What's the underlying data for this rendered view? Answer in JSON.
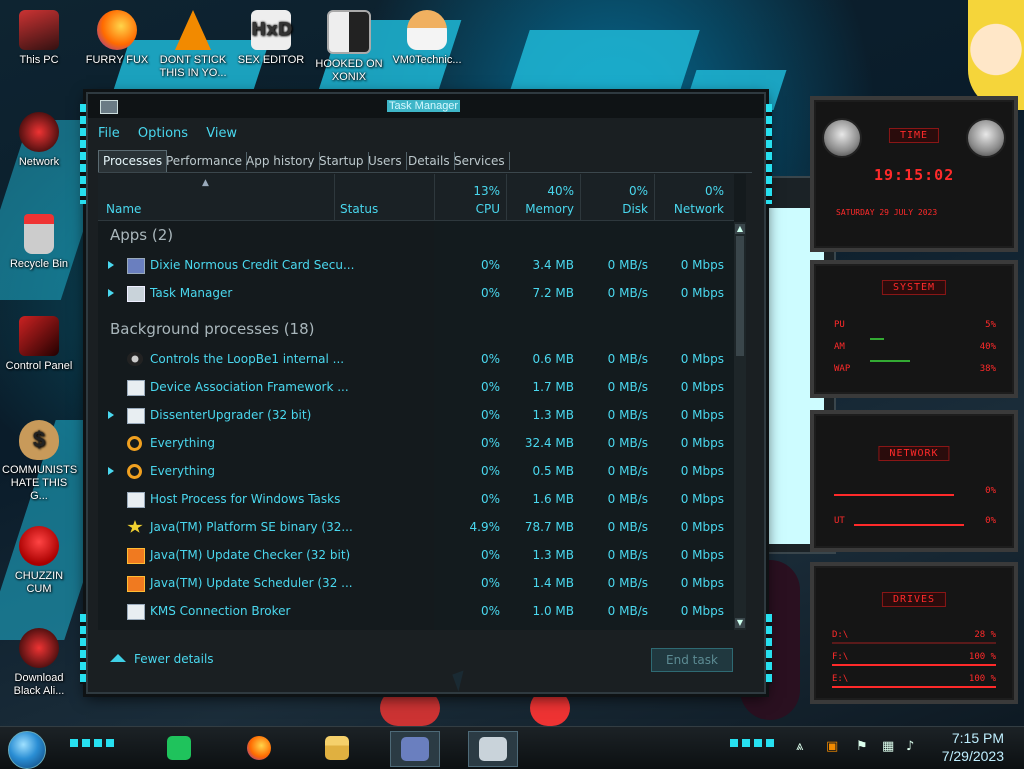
{
  "desktop_icons": [
    {
      "id": "this-pc",
      "label": "This PC"
    },
    {
      "id": "furry-fux",
      "label": "FURRY FUX"
    },
    {
      "id": "dont-stick",
      "label": "DONT STICK THIS IN YO..."
    },
    {
      "id": "sex-editor",
      "label": "SEX EDITOR"
    },
    {
      "id": "hooked-on-xonix",
      "label": "HOOKED ON XONIX"
    },
    {
      "id": "vm0technic",
      "label": "VM0Technic..."
    },
    {
      "id": "network",
      "label": "Network"
    },
    {
      "id": "recycle-bin",
      "label": "Recycle Bin"
    },
    {
      "id": "control-panel",
      "label": "Control Panel"
    },
    {
      "id": "communists",
      "label": "COMMUNISTS HATE THIS G..."
    },
    {
      "id": "chuzzin-cum",
      "label": "CHUZZIN CUM"
    },
    {
      "id": "download-black-ali",
      "label": "Download Black Ali..."
    }
  ],
  "task_manager": {
    "title": "Task Manager",
    "menu": [
      "File",
      "Options",
      "View"
    ],
    "tabs": [
      "Processes",
      "Performance",
      "App history",
      "Startup",
      "Users",
      "Details",
      "Services"
    ],
    "columns": {
      "name": "Name",
      "status": "Status",
      "cpu_pct": "13%",
      "cpu": "CPU",
      "memory_pct": "40%",
      "memory": "Memory",
      "disk_pct": "0%",
      "disk": "Disk",
      "network_pct": "0%",
      "network": "Network"
    },
    "groups": {
      "apps": "Apps (2)",
      "background": "Background processes (18)"
    },
    "apps": [
      {
        "name": "Dixie Normous Credit Card Secu...",
        "cpu": "0%",
        "memory": "3.4 MB",
        "disk": "0 MB/s",
        "network": "0 Mbps",
        "expandable": true,
        "icon": "card-icon"
      },
      {
        "name": "Task Manager",
        "cpu": "0%",
        "memory": "7.2 MB",
        "disk": "0 MB/s",
        "network": "0 Mbps",
        "expandable": true,
        "icon": "task-manager-icon"
      }
    ],
    "background": [
      {
        "name": "Controls the LoopBe1 internal ...",
        "cpu": "0%",
        "memory": "0.6 MB",
        "disk": "0 MB/s",
        "network": "0 Mbps",
        "expandable": false,
        "icon": "loopbe-icon"
      },
      {
        "name": "Device Association Framework ...",
        "cpu": "0%",
        "memory": "1.7 MB",
        "disk": "0 MB/s",
        "network": "0 Mbps",
        "expandable": false,
        "icon": "window-icon"
      },
      {
        "name": "DissenterUpgrader (32 bit)",
        "cpu": "0%",
        "memory": "1.3 MB",
        "disk": "0 MB/s",
        "network": "0 Mbps",
        "expandable": true,
        "icon": "window-icon"
      },
      {
        "name": "Everything",
        "cpu": "0%",
        "memory": "32.4 MB",
        "disk": "0 MB/s",
        "network": "0 Mbps",
        "expandable": false,
        "icon": "search-icon"
      },
      {
        "name": "Everything",
        "cpu": "0%",
        "memory": "0.5 MB",
        "disk": "0 MB/s",
        "network": "0 Mbps",
        "expandable": true,
        "icon": "search-icon"
      },
      {
        "name": "Host Process for Windows Tasks",
        "cpu": "0%",
        "memory": "1.6 MB",
        "disk": "0 MB/s",
        "network": "0 Mbps",
        "expandable": false,
        "icon": "window-icon"
      },
      {
        "name": "Java(TM) Platform SE binary (32...",
        "cpu": "4.9%",
        "memory": "78.7 MB",
        "disk": "0 MB/s",
        "network": "0 Mbps",
        "expandable": false,
        "icon": "java-star-icon"
      },
      {
        "name": "Java(TM) Update Checker (32 bit)",
        "cpu": "0%",
        "memory": "1.3 MB",
        "disk": "0 MB/s",
        "network": "0 Mbps",
        "expandable": false,
        "icon": "java-icon"
      },
      {
        "name": "Java(TM) Update Scheduler (32 ...",
        "cpu": "0%",
        "memory": "1.4 MB",
        "disk": "0 MB/s",
        "network": "0 Mbps",
        "expandable": false,
        "icon": "java-icon"
      },
      {
        "name": "KMS Connection Broker",
        "cpu": "0%",
        "memory": "1.0 MB",
        "disk": "0 MB/s",
        "network": "0 Mbps",
        "expandable": false,
        "icon": "window-icon"
      }
    ],
    "fewer_details": "Fewer details",
    "end_task": "End task"
  },
  "gadget": {
    "time_title": "TIME",
    "time": "19:15:02",
    "date": "SATURDAY 29 JULY 2023",
    "system_title": "SYSTEM",
    "cpu_label": "PU",
    "cpu_val": "5%",
    "ram_label": "AM",
    "ram_val": "40%",
    "swap_label": "WAP",
    "swap_val": "38%",
    "network_title": "NETWORK",
    "net_in": "0%",
    "net_out_label": "UT",
    "net_out": "0%",
    "drives_title": "DRIVES",
    "drives": [
      {
        "label": "D:\\",
        "val": "28 %"
      },
      {
        "label": "F:\\",
        "val": "100 %"
      },
      {
        "label": "E:\\",
        "val": "100 %"
      }
    ]
  },
  "taskbar": {
    "time": "7:15 PM",
    "date": "7/29/2023"
  }
}
